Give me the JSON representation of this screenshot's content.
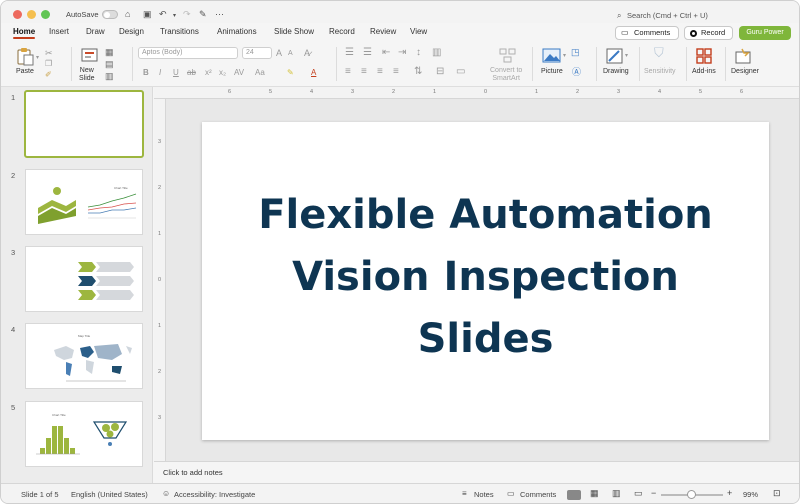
{
  "app": {
    "autosave_label": "AutoSave",
    "search_placeholder": "Search (Cmd + Ctrl + U)"
  },
  "tabs": [
    "Home",
    "Insert",
    "Draw",
    "Design",
    "Transitions",
    "Animations",
    "Slide Show",
    "Record",
    "Review",
    "View"
  ],
  "header_buttons": {
    "comments": "Comments",
    "record": "Record",
    "guru": "Guru Power"
  },
  "ribbon": {
    "paste": "Paste",
    "new_slide": "New\nSlide",
    "font_name": "Aptos (Body)",
    "font_size": "24",
    "convert_smartart": "Convert to\nSmartArt",
    "picture": "Picture",
    "drawing": "Drawing",
    "sensitivity": "Sensitivity",
    "add_ins": "Add-ins",
    "designer": "Designer"
  },
  "thumbnails": [
    {
      "num": "1"
    },
    {
      "num": "2"
    },
    {
      "num": "3"
    },
    {
      "num": "4"
    },
    {
      "num": "5"
    }
  ],
  "ruler": {
    "h_numbers": [
      "6",
      "5",
      "4",
      "3",
      "2",
      "1",
      "0",
      "1",
      "2",
      "3",
      "4",
      "5",
      "6"
    ],
    "v_numbers": [
      "3",
      "2",
      "1",
      "0",
      "1",
      "2",
      "3"
    ]
  },
  "slide": {
    "title_lines": [
      "Flexible Automation",
      "Vision Inspection",
      "Slides"
    ]
  },
  "notes_placeholder": "Click to add notes",
  "status": {
    "slide_info": "Slide 1 of 5",
    "language": "English (United States)",
    "accessibility": "Accessibility: Investigate",
    "notes": "Notes",
    "comments": "Comments",
    "zoom": "99%"
  },
  "colors": {
    "accent_green": "#9db63f",
    "title_navy": "#0e3552",
    "tab_underline": "#c43e1c",
    "guru_button": "#7fb63b"
  }
}
